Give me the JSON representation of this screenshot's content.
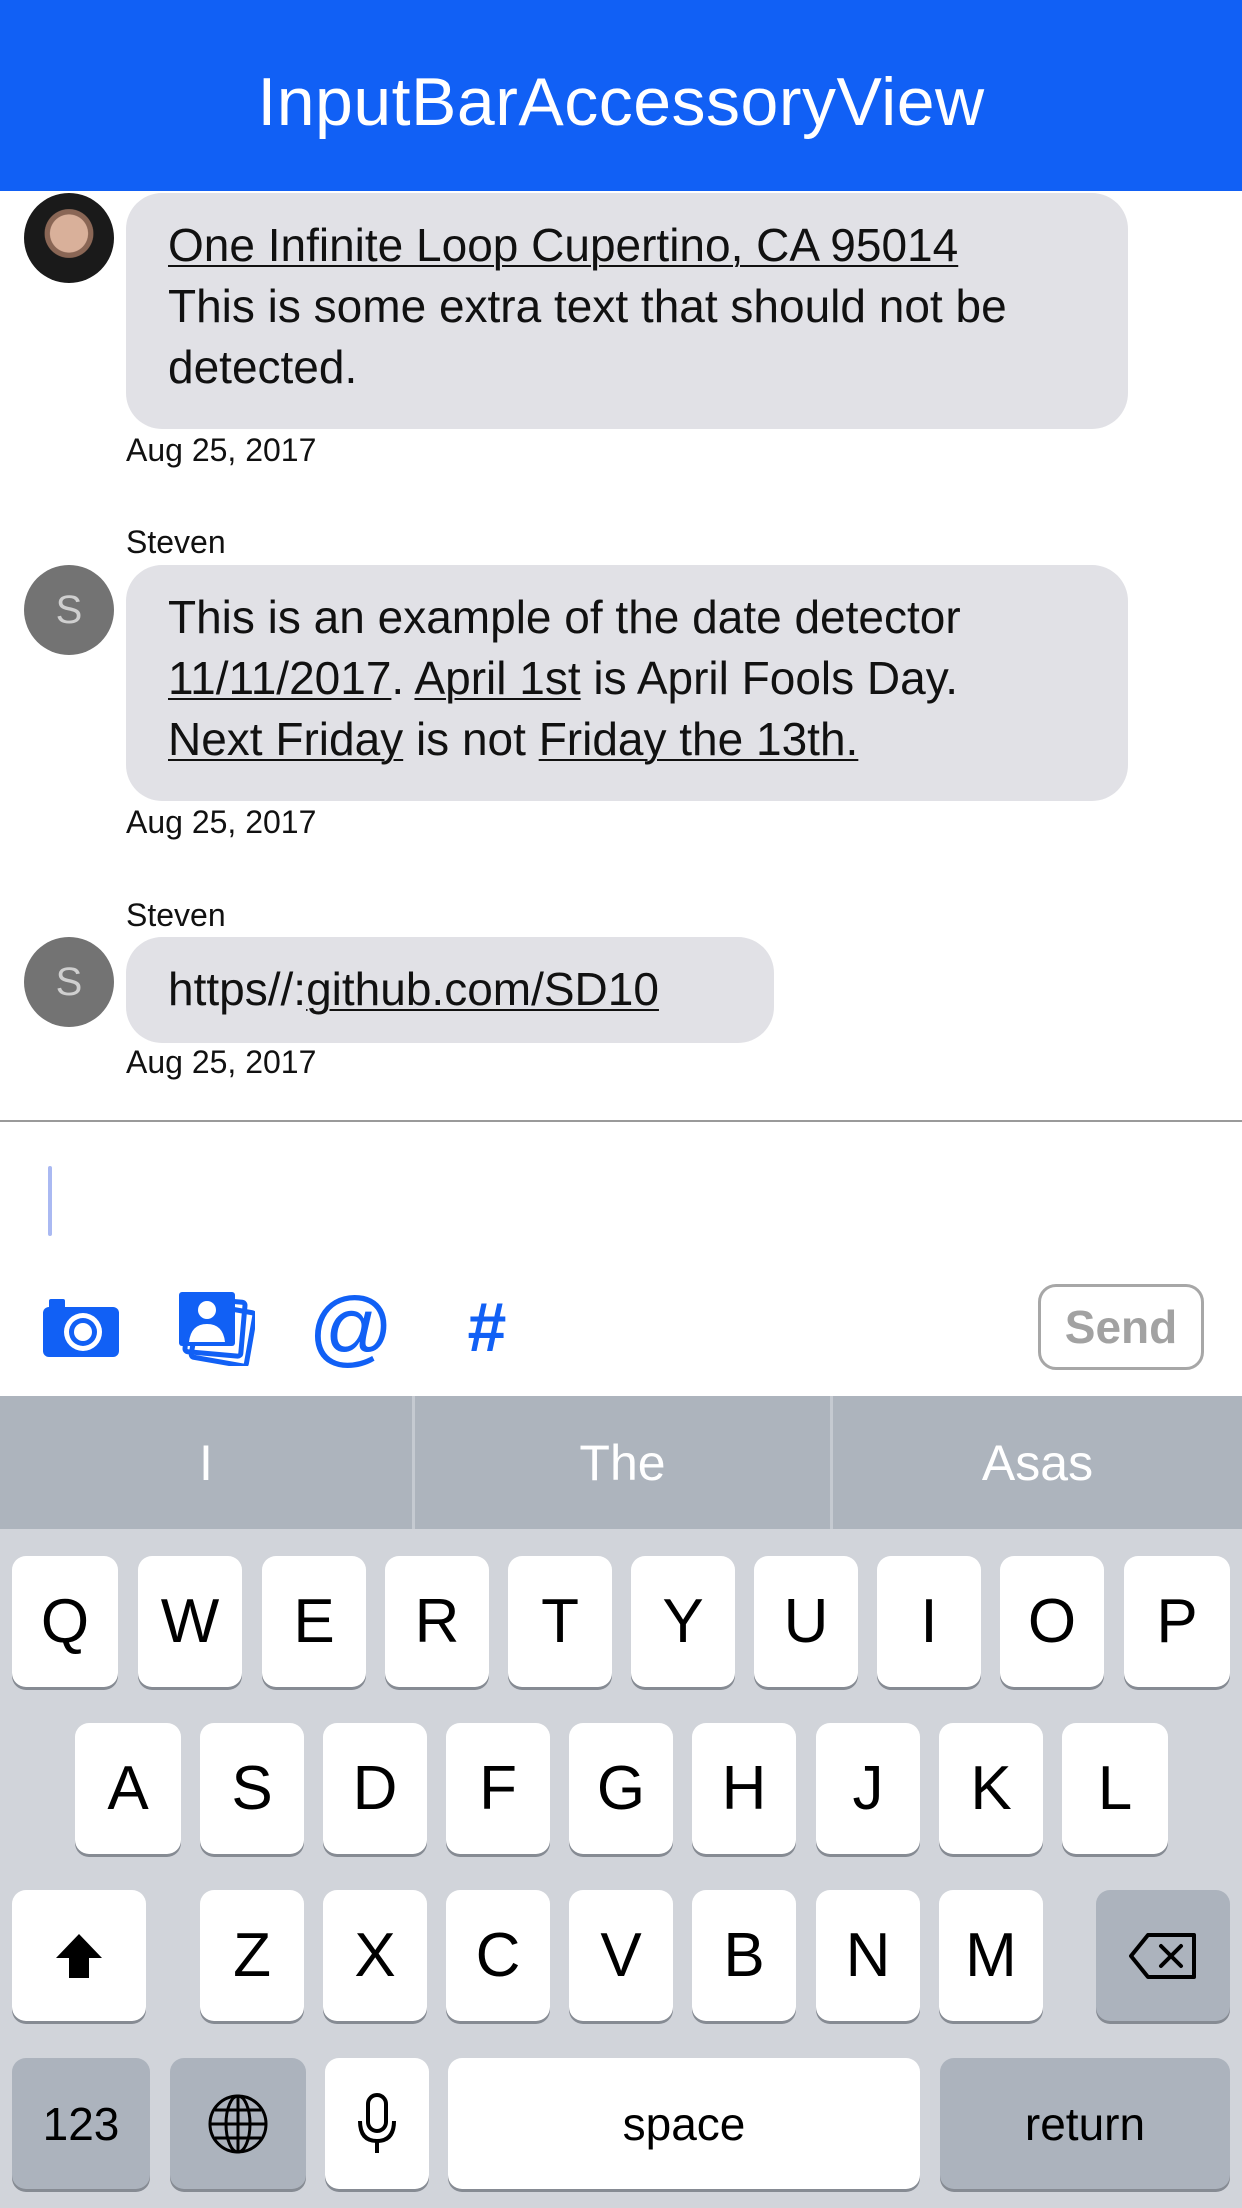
{
  "nav": {
    "title": "InputBarAccessoryView"
  },
  "messages": [
    {
      "sender": "",
      "avatar": "photo",
      "parts": [
        {
          "text": "One Infinite Loop Cupertino, CA 95014",
          "link": true
        },
        {
          "text": "This is some extra text that should not be detected.",
          "link": false
        }
      ],
      "date": "Aug 25, 2017"
    },
    {
      "sender": "Steven",
      "avatar": "S",
      "parts": [
        {
          "text": "This is an example of the date detector",
          "link": false
        },
        {
          "text": "11/11/2017",
          "link": true
        },
        {
          "text": ". ",
          "link": false
        },
        {
          "text": "April 1st",
          "link": true
        },
        {
          "text": " is April Fools Day.",
          "link": false
        },
        {
          "text": "Next Friday",
          "link": true
        },
        {
          "text": " is not ",
          "link": false
        },
        {
          "text": "Friday the 13th.",
          "link": true
        }
      ],
      "date": "Aug 25, 2017"
    },
    {
      "sender": "Steven",
      "avatar": "S",
      "parts": [
        {
          "text": "https//:",
          "link": false
        },
        {
          "text": "github.com/SD10",
          "link": true
        }
      ],
      "date": "Aug 25, 2017"
    }
  ],
  "input": {
    "value": "",
    "send_label": "Send"
  },
  "toolbar_icons": [
    "camera-icon",
    "photo-library-icon",
    "at-sign-icon",
    "hashtag-icon"
  ],
  "keyboard": {
    "predictions": [
      "I",
      "The",
      "Asas"
    ],
    "row1": [
      "Q",
      "W",
      "E",
      "R",
      "T",
      "Y",
      "U",
      "I",
      "O",
      "P"
    ],
    "row2": [
      "A",
      "S",
      "D",
      "F",
      "G",
      "H",
      "J",
      "K",
      "L"
    ],
    "row3": [
      "Z",
      "X",
      "C",
      "V",
      "B",
      "N",
      "M"
    ],
    "numbers_label": "123",
    "space_label": "space",
    "return_label": "return"
  },
  "colors": {
    "accent": "#1160f5",
    "bubble": "#e1e1e6"
  }
}
